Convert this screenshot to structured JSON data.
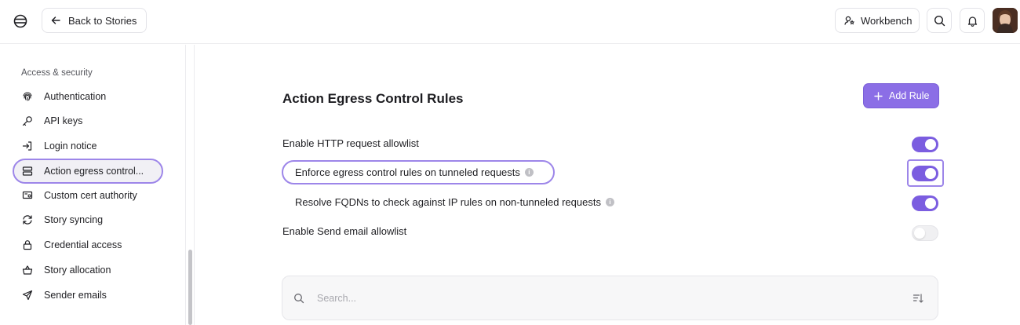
{
  "header": {
    "back_label": "Back to Stories",
    "workbench_label": "Workbench"
  },
  "sidebar": {
    "heading": "Access & security",
    "items": [
      {
        "label": "Authentication",
        "icon": "fingerprint-icon"
      },
      {
        "label": "API keys",
        "icon": "key-icon"
      },
      {
        "label": "Login notice",
        "icon": "login-icon"
      },
      {
        "label": "Action egress control...",
        "icon": "server-icon",
        "active": true
      },
      {
        "label": "Custom cert authority",
        "icon": "certificate-icon"
      },
      {
        "label": "Story syncing",
        "icon": "sync-icon"
      },
      {
        "label": "Credential access",
        "icon": "lock-icon"
      },
      {
        "label": "Story allocation",
        "icon": "basket-icon"
      },
      {
        "label": "Sender emails",
        "icon": "send-icon"
      }
    ]
  },
  "main": {
    "title": "Action Egress Control Rules",
    "add_rule_label": "Add Rule",
    "settings": [
      {
        "label": "Enable HTTP request allowlist",
        "enabled": true
      },
      {
        "label": "Enforce egress control rules on tunneled requests",
        "enabled": true,
        "info": true
      },
      {
        "label": "Resolve FQDNs to check against IP rules on non-tunneled requests",
        "enabled": true,
        "info": true
      },
      {
        "label": "Enable Send email allowlist",
        "enabled": false
      }
    ],
    "search": {
      "placeholder": "Search...",
      "value": ""
    }
  },
  "colors": {
    "accent": "#7b5de0",
    "highlight": "#9d86e9",
    "button": "#8b6ee6"
  }
}
